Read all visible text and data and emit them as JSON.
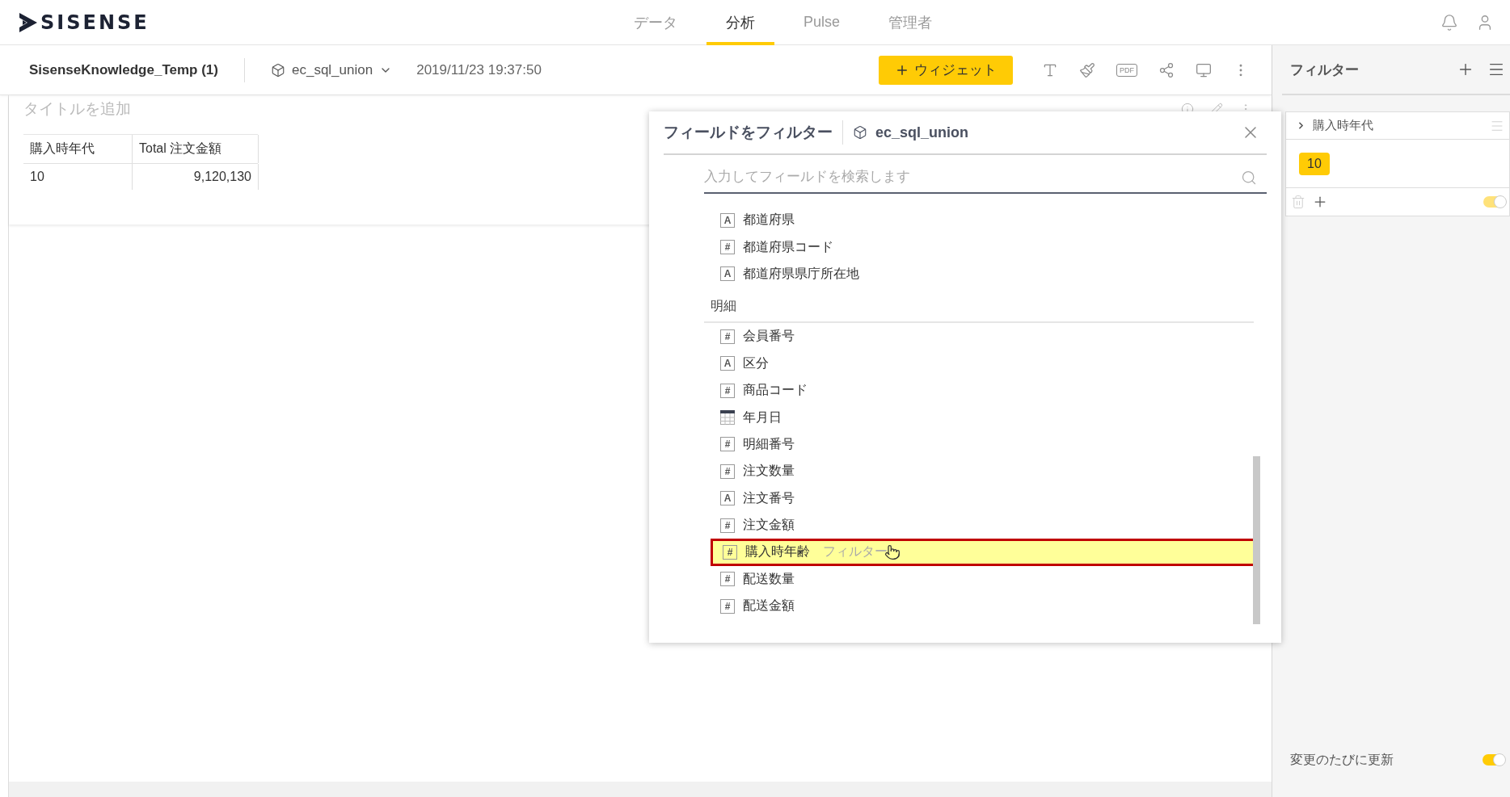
{
  "logo": {
    "text": "SISENSE"
  },
  "nav": {
    "tabs": [
      {
        "label": "データ",
        "selected": false
      },
      {
        "label": "分析",
        "selected": true
      },
      {
        "label": "Pulse",
        "selected": false
      },
      {
        "label": "管理者",
        "selected": false
      }
    ]
  },
  "dashboard": {
    "title": "SisenseKnowledge_Temp (1)",
    "datasource": "ec_sql_union",
    "updated": "2019/11/23 19:37:50",
    "widget_button": "ウィジェット",
    "pdf_label": "PDF"
  },
  "widget": {
    "title_placeholder": "タイトルを追加",
    "table": {
      "columns": [
        "購入時年代",
        "Total 注文金額"
      ],
      "rows": [
        [
          "10",
          "9,120,130"
        ]
      ]
    }
  },
  "field_dialog": {
    "title": "フィールドをフィルター",
    "datasource": "ec_sql_union",
    "search": {
      "placeholder": "入力してフィールドを検索します"
    },
    "groups": [
      {
        "fields": [
          {
            "label": "都道府県",
            "kind": "text",
            "glyph": "A",
            "hovered": false
          },
          {
            "label": "都道府県コード",
            "kind": "number",
            "glyph": "#",
            "hovered": false
          },
          {
            "label": "都道府県県庁所在地",
            "kind": "text",
            "glyph": "A",
            "hovered": false
          }
        ]
      },
      {
        "label": "明細",
        "fields": [
          {
            "label": "会員番号",
            "kind": "number",
            "glyph": "#",
            "hovered": false
          },
          {
            "label": "区分",
            "kind": "text",
            "glyph": "A",
            "hovered": false
          },
          {
            "label": "商品コード",
            "kind": "number",
            "glyph": "#",
            "hovered": false
          },
          {
            "label": "年月日",
            "kind": "date",
            "hovered": false
          },
          {
            "label": "明細番号",
            "kind": "number",
            "glyph": "#",
            "hovered": false
          },
          {
            "label": "注文数量",
            "kind": "number",
            "glyph": "#",
            "hovered": false
          },
          {
            "label": "注文番号",
            "kind": "text",
            "glyph": "A",
            "hovered": false
          },
          {
            "label": "注文金額",
            "kind": "number",
            "glyph": "#",
            "hovered": false
          },
          {
            "label": "購入時年齢",
            "kind": "number",
            "glyph": "#",
            "hovered": true,
            "action_hint": "フィルター"
          },
          {
            "label": "配送数量",
            "kind": "number",
            "glyph": "#",
            "hovered": false
          },
          {
            "label": "配送金額",
            "kind": "number",
            "glyph": "#",
            "hovered": false
          }
        ]
      }
    ]
  },
  "filters_panel": {
    "title": "フィルター",
    "filters": [
      {
        "name": "購入時年代",
        "expanded": false,
        "values": [
          "10"
        ],
        "enabled": true
      }
    ],
    "auto_update": {
      "label": "変更のたびに更新",
      "on": true
    }
  }
}
